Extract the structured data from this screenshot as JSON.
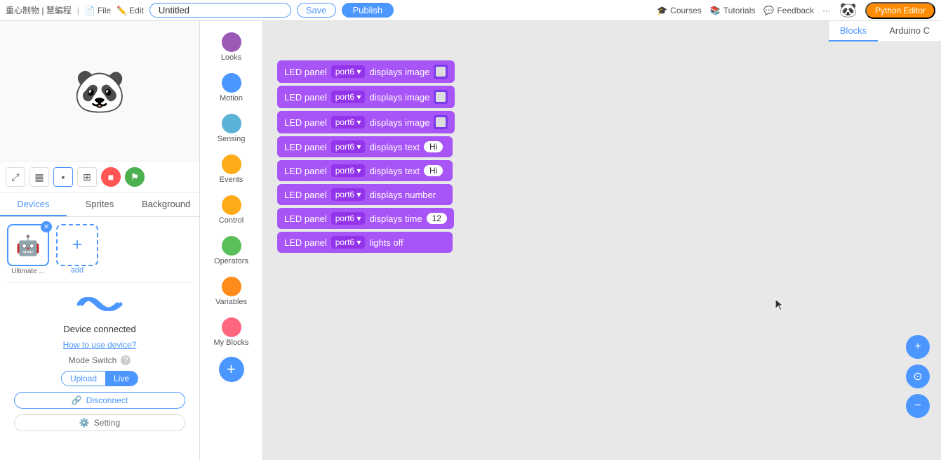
{
  "topbar": {
    "brand": "重心制物 | 慧編程",
    "file_label": "File",
    "edit_label": "Edit",
    "title_placeholder": "Untitled",
    "title_value": "Untitled",
    "save_label": "Save",
    "publish_label": "Publish",
    "courses_label": "Courses",
    "tutorials_label": "Tutorials",
    "feedback_label": "Feedback",
    "more_label": "···",
    "python_label": "Python Editor"
  },
  "left": {
    "tabs": [
      {
        "id": "devices",
        "label": "Devices"
      },
      {
        "id": "sprites",
        "label": "Sprites"
      },
      {
        "id": "background",
        "label": "Background"
      }
    ],
    "active_tab": "devices",
    "device_name": "Ultimate ...",
    "add_label": "add",
    "conn_status": "Device connected",
    "conn_link": "How to use device?",
    "mode_label": "Mode Switch",
    "mode_upload": "Upload",
    "mode_live": "Live",
    "disconnect_label": "Disconnect",
    "setting_label": "Setting"
  },
  "block_categories": [
    {
      "id": "looks",
      "label": "Looks",
      "color": "#9B59B6"
    },
    {
      "id": "motion",
      "label": "Motion",
      "color": "#4C97FF"
    },
    {
      "id": "sensing",
      "label": "Sensing",
      "color": "#5CB1D6"
    },
    {
      "id": "events",
      "label": "Events",
      "color": "#FFAB19"
    },
    {
      "id": "control",
      "label": "Control",
      "color": "#FFAB19"
    },
    {
      "id": "operators",
      "label": "Operators",
      "color": "#59C059"
    },
    {
      "id": "variables",
      "label": "Variables",
      "color": "#FF8C1A"
    },
    {
      "id": "myblocks",
      "label": "My Blocks",
      "color": "#FF6680"
    }
  ],
  "code_blocks": [
    {
      "id": 1,
      "prefix": "LED panel",
      "port": "port6",
      "action": "displays image",
      "has_image": true
    },
    {
      "id": 2,
      "prefix": "LED panel",
      "port": "port6",
      "action": "displays image",
      "has_image": true
    },
    {
      "id": 3,
      "prefix": "LED panel",
      "port": "port6",
      "action": "displays image",
      "has_image": true
    },
    {
      "id": 4,
      "prefix": "LED panel",
      "port": "port6",
      "action": "displays text",
      "pill": "Hi"
    },
    {
      "id": 5,
      "prefix": "LED panel",
      "port": "port6",
      "action": "displays text",
      "pill": "Hi"
    },
    {
      "id": 6,
      "prefix": "LED panel",
      "port": "port6",
      "action": "displays number",
      "pill": ""
    },
    {
      "id": 7,
      "prefix": "LED panel",
      "port": "port6",
      "action": "displays time",
      "pill": "12"
    },
    {
      "id": 8,
      "prefix": "LED panel",
      "port": "port6",
      "action": "lights off",
      "pill": ""
    }
  ],
  "code_tabs": [
    {
      "id": "blocks",
      "label": "Blocks",
      "active": true
    },
    {
      "id": "arduino",
      "label": "Arduino C",
      "active": false
    }
  ],
  "fab": {
    "zoom_in": "+",
    "zoom_fit": "⊙",
    "zoom_out": "−"
  }
}
